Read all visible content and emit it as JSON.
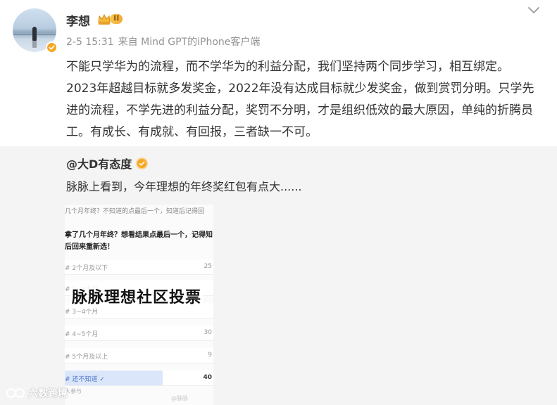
{
  "post": {
    "username": "李想",
    "vip_level": "II",
    "meta": {
      "time": "2-5 15:31",
      "source": "来自 Mind GPT的iPhone客户端"
    },
    "text": "不能只学华为的流程，而不学华为的利益分配，我们坚持两个同步学习，相互绑定。2023年超越目标就多发奖金，2022年没有达成目标就少发奖金，做到赏罚分明。只学先进的流程，不学先进的利益分配，奖罚不分明，才是组织低效的最大原因，单纯的折腾员工。有成长、有成就、有回报，三者缺一不可。"
  },
  "repost": {
    "username": "@大D有态度",
    "text": "脉脉上看到，今年理想的年终奖红包有点大......",
    "image": {
      "question_top": "几个月年终？不知道的点最后一个，知道后记得回",
      "question_main": "拿了几个月年终？想看结果点最后一个，记得知后回来重新选！",
      "overlay_title": "脉脉理想社区投票",
      "options": [
        {
          "label": "# 2个月及以下",
          "value": "25"
        },
        {
          "label": "# 2~3个月",
          "value": ""
        },
        {
          "label": "# 3~4个月",
          "value": ""
        },
        {
          "label": "# 4~5个月",
          "value": "30"
        },
        {
          "label": "# 5个月及以上",
          "value": "9"
        },
        {
          "label": "# 还不知道 ✓",
          "value": "40",
          "selected": true,
          "fraction": 0.66
        }
      ],
      "footer": "人参与",
      "watermark": "@脉脉"
    }
  },
  "watermark": {
    "text": "六数跨境"
  },
  "colors": {
    "accent_badge": "#f5a623",
    "repost_bg": "#f4f4f4",
    "meta_text": "#939393"
  },
  "icons": {
    "more": "chevron-down-icon",
    "verified": "verified-check-icon",
    "vip": "crown-icon"
  }
}
